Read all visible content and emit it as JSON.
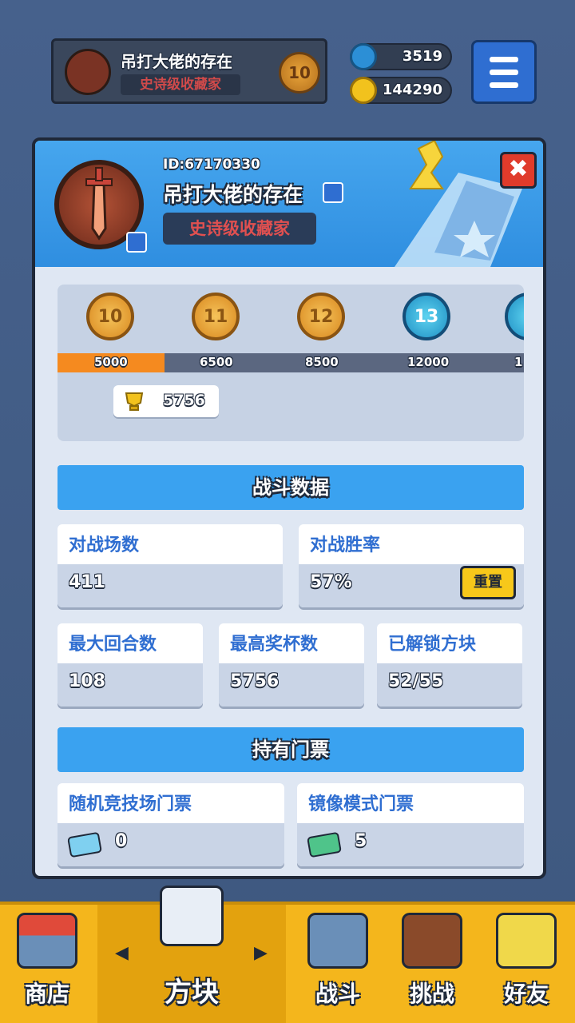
{
  "top_bar": {
    "player_name": "吊打大佬的存在",
    "title": "史诗级收藏家",
    "rank_level": "10",
    "gems": "3519",
    "coins": "144290",
    "menu_icon": "hamburger-menu-icon"
  },
  "profile": {
    "id_label": "ID:67170330",
    "name": "吊打大佬的存在",
    "title": "史诗级收藏家",
    "close_label": "✖"
  },
  "rank_track": {
    "ranks": [
      {
        "level": "10",
        "threshold": "5000"
      },
      {
        "level": "11",
        "threshold": "6500"
      },
      {
        "level": "12",
        "threshold": "8500"
      },
      {
        "level": "13",
        "threshold": "12000"
      },
      {
        "level": "",
        "threshold": "1"
      }
    ],
    "progress_fraction": 0.23,
    "current_trophies": "5756"
  },
  "battle_stats": {
    "section_title": "战斗数据",
    "matches_label": "对战场数",
    "matches_value": "411",
    "winrate_label": "对战胜率",
    "winrate_value": "57%",
    "reset_label": "重置",
    "max_rounds_label": "最大回合数",
    "max_rounds_value": "108",
    "max_trophies_label": "最高奖杯数",
    "max_trophies_value": "5756",
    "unlocked_label": "已解锁方块",
    "unlocked_value": "52/55"
  },
  "tickets": {
    "section_title": "持有门票",
    "arena_label": "随机竞技场门票",
    "arena_value": "0",
    "mirror_label": "镜像模式门票",
    "mirror_value": "5"
  },
  "nav": {
    "items": [
      {
        "label": "商店",
        "icon": "shop-icon"
      },
      {
        "label": "方块",
        "icon": "block-icon"
      },
      {
        "label": "战斗",
        "icon": "battle-icon"
      },
      {
        "label": "挑战",
        "icon": "challenge-icon"
      },
      {
        "label": "好友",
        "icon": "friends-icon"
      }
    ],
    "prev_arrow": "◀",
    "next_arrow": "▶"
  },
  "colors": {
    "header_blue": "#3aa2f0",
    "progress_orange": "#f58a1f",
    "title_red": "#e05050",
    "nav_yellow": "#f4b61c"
  }
}
